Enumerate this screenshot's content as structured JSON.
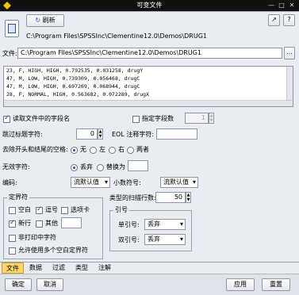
{
  "window": {
    "title": "可变文件"
  },
  "toolbar": {
    "refresh_label": "刷新"
  },
  "header": {
    "path": "C:\\Program Files\\SPSSInc\\Clementine12.0\\Demos\\DRUG1"
  },
  "file": {
    "label": "文件:",
    "value": "C:\\Program Files\\SPSSInc\\Clementine12.0\\Demos\\DRUG1"
  },
  "preview": {
    "rows": [
      "23, F, HIGH, HIGH, 0.792535, 0.031258, drugY",
      "47, M, LOW, HIGH, 0.739309, 0.056468, drugC",
      "47, M, LOW, HIGH, 0.697269, 0.068944, drugC",
      "28, F, NORMAL, HIGH, 0.563682, 0.072289, drugX"
    ]
  },
  "options": {
    "read_names_label": "读取文件中的字段名",
    "specify_count_label": "指定字段数",
    "field_count_value": "1",
    "skip_header_label": "跳过标题字符:",
    "skip_header_value": "0",
    "eol_label": "EOL 注释字符:",
    "eol_value": "",
    "strip_label": "去除开头和结尾的空格:",
    "strip_options": [
      "无",
      "左",
      "右",
      "两者"
    ],
    "invalid_label": "无效字符:",
    "invalid_options": [
      "丢弃",
      "替换为"
    ],
    "replace_value": "",
    "encoding_label": "编码:",
    "encoding_value": "流默认值",
    "decimal_label": "小数符号:",
    "decimal_value": "流默认值",
    "scan_lines_label": "类型的扫描行数:",
    "scan_lines_value": "50"
  },
  "delimiters": {
    "title": "定界符",
    "space_label": "空白",
    "comma_label": "逗号",
    "tab_label": "选项卡",
    "newline_label": "新行",
    "other_label": "其他",
    "other_value": "",
    "nonprint_label": "非打印中字符",
    "multiple_label": "允许使用多个空白定界符"
  },
  "quotes": {
    "title": "引号",
    "single_label": "单引号:",
    "single_value": "丢弃",
    "double_label": "双引号:",
    "double_value": "丢弃"
  },
  "tabs": [
    "文件",
    "数据",
    "过滤",
    "类型",
    "注解"
  ],
  "footer": {
    "ok": "确定",
    "cancel": "取消",
    "apply": "应用",
    "reset": "重置"
  }
}
